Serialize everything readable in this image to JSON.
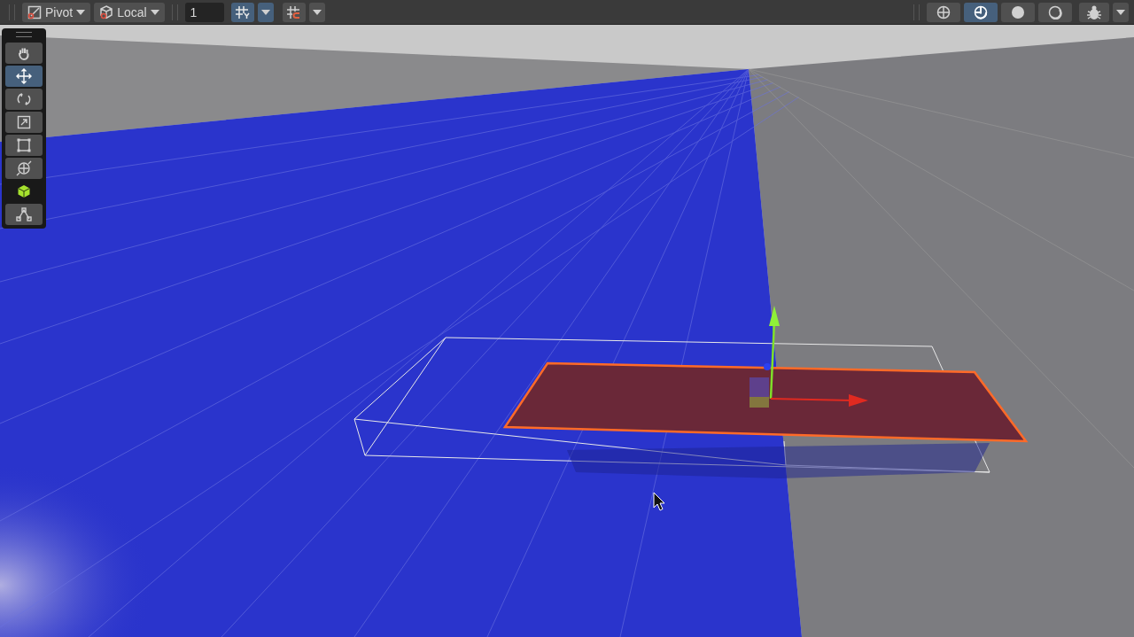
{
  "toolbar": {
    "pivot_dropdown": {
      "label": "Pivot"
    },
    "space_dropdown": {
      "label": "Local"
    },
    "increment_field": {
      "value": "1"
    },
    "snap_buttons": [
      {
        "kind": "grid",
        "selected": true
      },
      {
        "kind": "increment",
        "selected": false
      }
    ],
    "draw_modes": [
      {
        "kind": "wireframe",
        "selected": false
      },
      {
        "kind": "shaded-wireframe",
        "selected": true
      },
      {
        "kind": "shaded",
        "selected": false
      },
      {
        "kind": "unlit",
        "selected": false
      }
    ]
  },
  "tools": [
    {
      "kind": "hand",
      "selected": false
    },
    {
      "kind": "move",
      "selected": true
    },
    {
      "kind": "rotate",
      "selected": false
    },
    {
      "kind": "scale",
      "selected": false
    },
    {
      "kind": "rect",
      "selected": false
    },
    {
      "kind": "transform",
      "selected": false
    },
    {
      "kind": "cube",
      "selected": false
    },
    {
      "kind": "path",
      "selected": false
    }
  ]
}
